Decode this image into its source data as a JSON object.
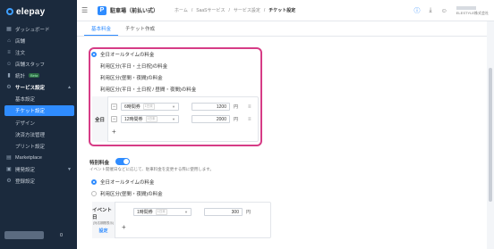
{
  "sidebar": {
    "logo": "elepay",
    "items": [
      {
        "label": "ダッシュボード",
        "icon": "dashboard-icon"
      },
      {
        "label": "店舗",
        "icon": "store-icon"
      },
      {
        "label": "注文",
        "icon": "order-icon"
      },
      {
        "label": "店舗スタッフ",
        "icon": "staff-icon"
      },
      {
        "label": "統計",
        "icon": "stats-icon",
        "badge": "Beta"
      }
    ],
    "section": {
      "label": "サービス設定",
      "icon": "service-icon"
    },
    "sub_items": [
      {
        "label": "基本設定"
      },
      {
        "label": "チケット設定"
      },
      {
        "label": "デザイン"
      },
      {
        "label": "決済方法管理"
      },
      {
        "label": "プリント設定"
      }
    ],
    "bottom_items": [
      {
        "label": "Marketplace",
        "icon": "marketplace-icon"
      },
      {
        "label": "開発設定",
        "icon": "dev-icon"
      },
      {
        "label": "登録設定",
        "icon": "registration-icon"
      }
    ],
    "user_count": "0"
  },
  "header": {
    "app_badge": "P",
    "app_name": "駐車場（前払い式）",
    "breadcrumbs": [
      "ホーム",
      "SaaSサービス",
      "サービス設定",
      "チケット設定"
    ],
    "company": "ELESTYLE株式会社"
  },
  "tabs": [
    "基本料金",
    "チケット作成"
  ],
  "basic": {
    "options": [
      "全日オールタイムの料金",
      "利用区分(平日・土日祝)の料金",
      "利用区分(昼間・夜間)の料金",
      "利用区分(平日・土日祝 / 昼間・夜間)の料金"
    ],
    "slot_label": "全日",
    "rows": [
      {
        "duration": "6時間券",
        "hint": "1日未",
        "price": "1200",
        "unit": "円"
      },
      {
        "duration": "12時間券",
        "hint": "1日未",
        "price": "2000",
        "unit": "円"
      }
    ]
  },
  "special": {
    "label": "特別料金",
    "note": "イベント開催日などに応じて、駐車料金を変更する際に使用します。",
    "options": [
      "全日オールタイムの料金",
      "利用区分(昼間・夜間)の料金"
    ],
    "slot_label": "イベント日",
    "slot_sub": "(対応期間表示)",
    "slot_link": "設定",
    "row": {
      "duration": "1時間券",
      "hint": "1日未",
      "price": "300",
      "unit": "円"
    }
  }
}
